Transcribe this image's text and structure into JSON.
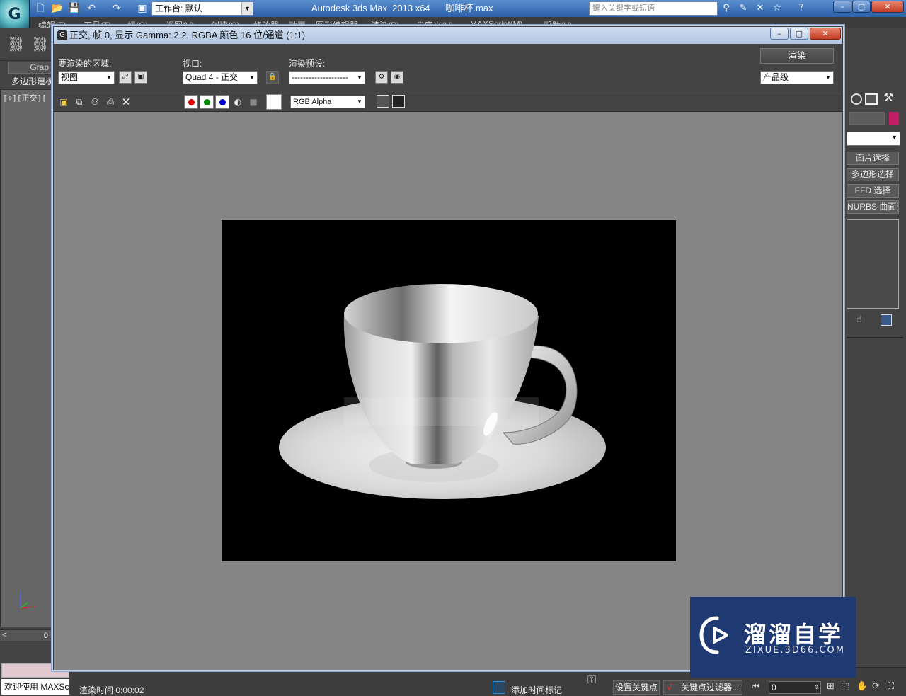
{
  "app": {
    "title": "Autodesk 3ds Max  2013 x64      咖啡杯.max",
    "workspace_prefix": "工作台: 默认",
    "search_placeholder": "键入关键字或短语"
  },
  "menu": [
    "编辑(E)",
    "工具(T)",
    "组(G)",
    "视图(V)",
    "创建(C)",
    "修改器",
    "动画",
    "图形编辑器",
    "渲染(R)",
    "自定义(U)",
    "MAXScript(M)",
    "帮助(H)"
  ],
  "left": {
    "graphite_tab": "Grap",
    "poly_label": "多边形建模",
    "viewport_label": "[+][正交][",
    "timeslider_value": "0"
  },
  "right_panel": {
    "buttons": [
      "面片选择",
      "多边形选择",
      "FFD 选择",
      "NURBS 曲面选择"
    ]
  },
  "render_window": {
    "title": "正交, 帧 0, 显示 Gamma: 2.2, RGBA 颜色 16 位/通道 (1:1)",
    "area_label": "要渲染的区域:",
    "area_value": "视图",
    "viewport_label": "视口:",
    "viewport_value": "Quad 4 - 正交",
    "preset_label": "渲染预设:",
    "preset_value": "--------------------",
    "render_button": "渲染",
    "quality_value": "产品级",
    "channel_value": "RGB Alpha"
  },
  "status": {
    "welcome": "欢迎使用 MAXScr",
    "render_time": "渲染时间  0:00:02",
    "add_time_tag": "添加时间标记",
    "set_key": "设置关键点",
    "key_filters": "关键点过滤器...",
    "frame": "0"
  },
  "watermark": {
    "name": "溜溜自学",
    "url": "ZIXUE.3D66.COM"
  },
  "colors": {
    "titlebar": "#3b6fb6",
    "render_bg": "#858585",
    "watermark": "#1f3a73",
    "red_channel": "#e00000",
    "green_channel": "#008a00",
    "blue_channel": "#0000d0"
  }
}
